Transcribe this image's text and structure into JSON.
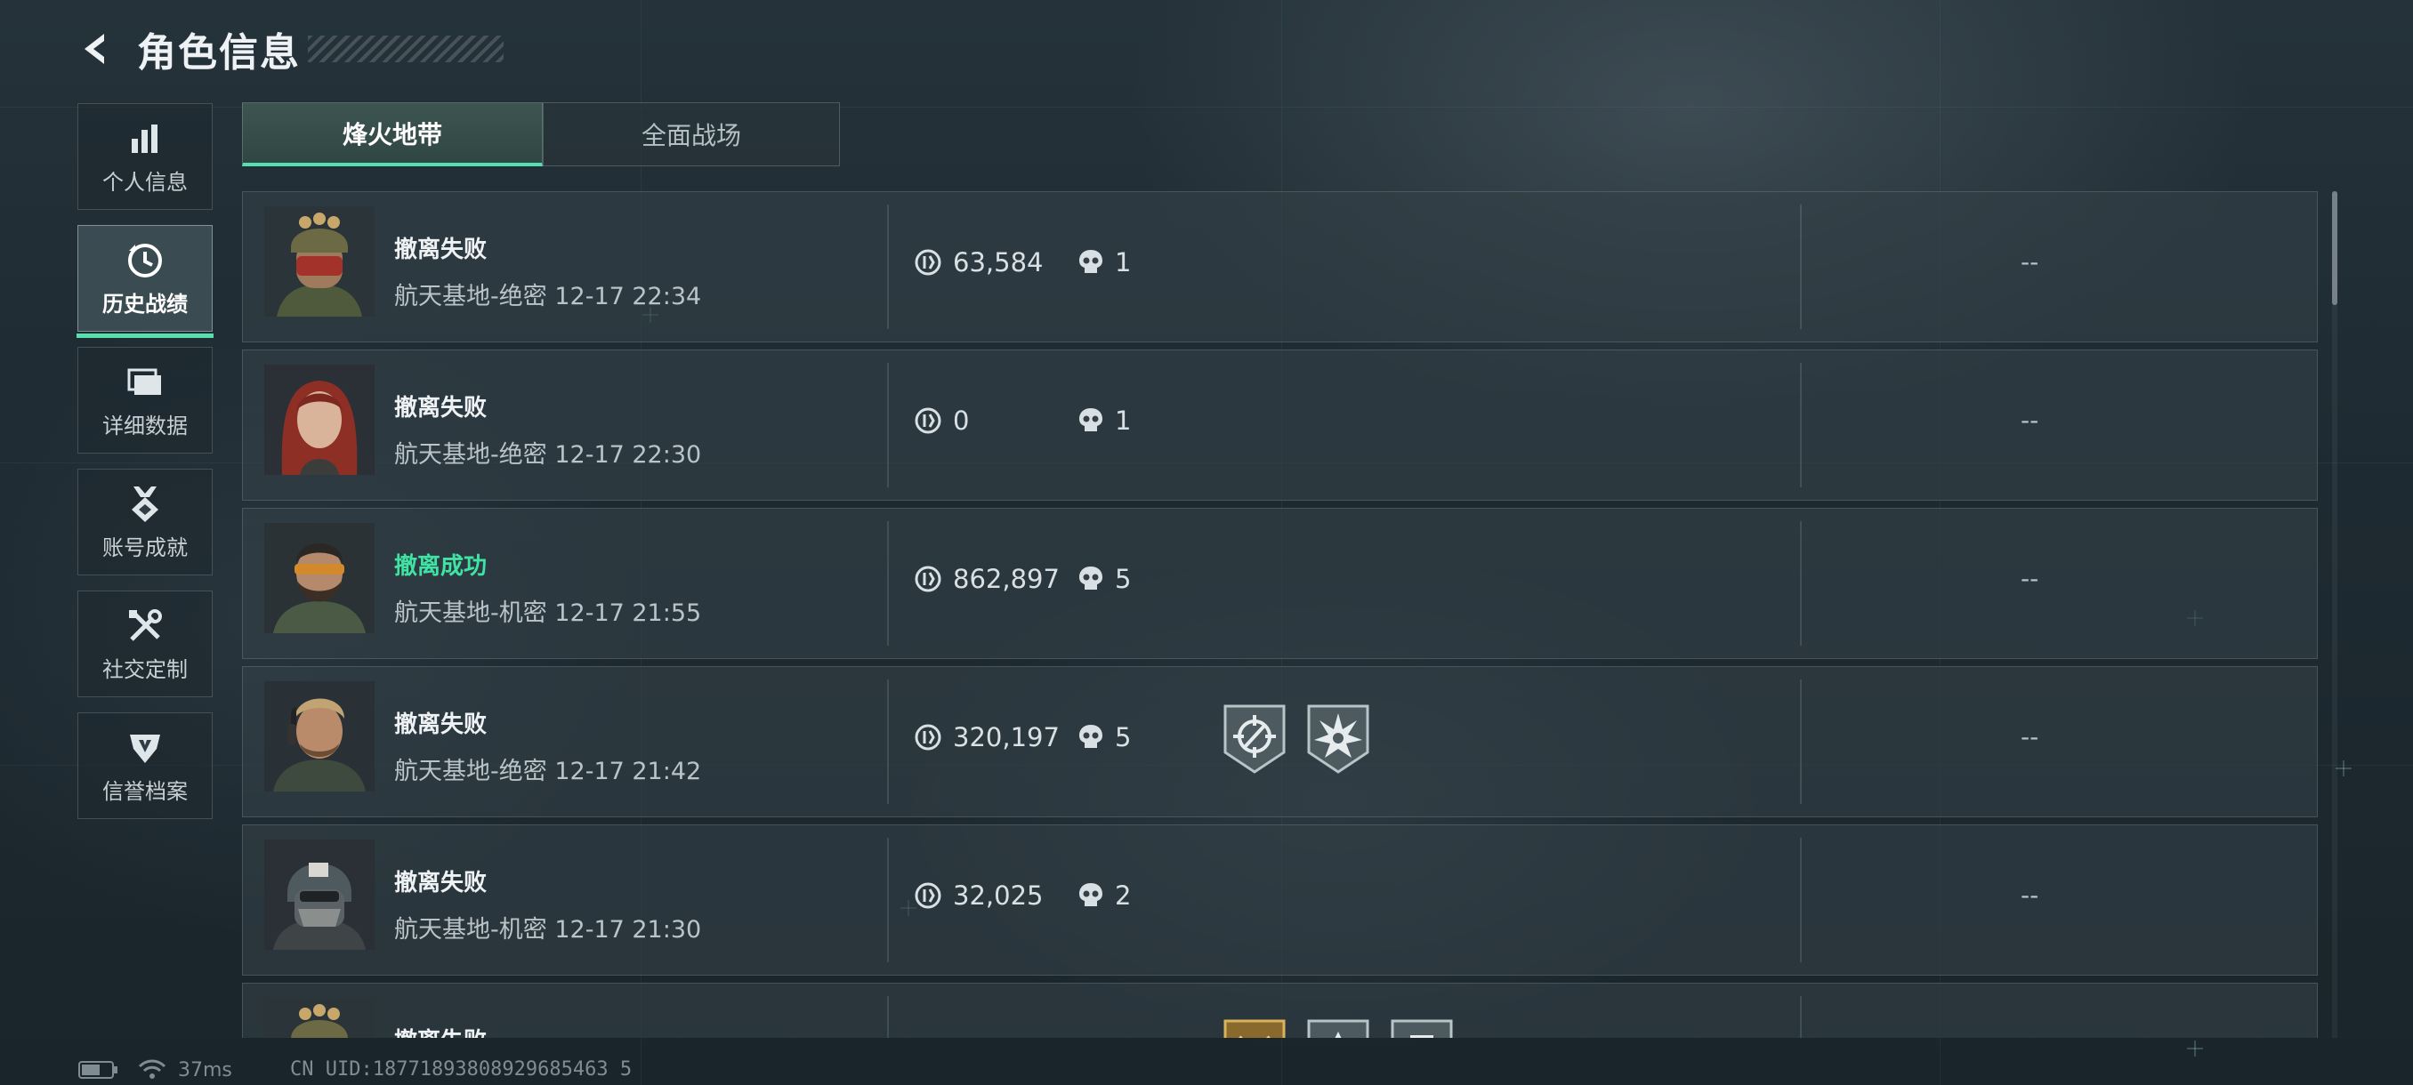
{
  "header": {
    "title": "角色信息",
    "back_icon": "chevron-left-icon"
  },
  "sidebar": {
    "items": [
      {
        "label": "个人信息",
        "icon": "bar-chart-icon",
        "active": false
      },
      {
        "label": "历史战绩",
        "icon": "clock-history-icon",
        "active": true
      },
      {
        "label": "详细数据",
        "icon": "folder-stack-icon",
        "active": false
      },
      {
        "label": "账号成就",
        "icon": "medal-icon",
        "active": false
      },
      {
        "label": "社交定制",
        "icon": "tools-icon",
        "active": false
      },
      {
        "label": "信誉档案",
        "icon": "shield-emblem-icon",
        "active": false
      }
    ]
  },
  "tabs": [
    {
      "label": "烽火地带",
      "active": true
    },
    {
      "label": "全面战场",
      "active": false
    }
  ],
  "records": [
    {
      "status": "撤离失败",
      "success": false,
      "map": "航天基地-绝密",
      "time": "12-17 22:34",
      "value": "63,584",
      "kills": "1",
      "extra": "--",
      "avatar": "operator-helmet-goggles"
    },
    {
      "status": "撤离失败",
      "success": false,
      "map": "航天基地-绝密",
      "time": "12-17 22:30",
      "value": "0",
      "kills": "1",
      "extra": "--",
      "avatar": "operator-red-hair"
    },
    {
      "status": "撤离成功",
      "success": true,
      "map": "航天基地-机密",
      "time": "12-17 21:55",
      "value": "862,897",
      "kills": "5",
      "extra": "--",
      "avatar": "operator-bearded-glasses"
    },
    {
      "status": "撤离失败",
      "success": false,
      "map": "航天基地-绝密",
      "time": "12-17 21:42",
      "value": "320,197",
      "kills": "5",
      "extra": "--",
      "avatar": "operator-headset",
      "badges": [
        "crosshair-badge-icon",
        "burst-badge-icon"
      ]
    },
    {
      "status": "撤离失败",
      "success": false,
      "map": "航天基地-机密",
      "time": "12-17 21:30",
      "value": "32,025",
      "kills": "2",
      "extra": "--",
      "avatar": "operator-masked-helmet"
    },
    {
      "status": "撤离失败",
      "success": false,
      "avatar": "operator-helmet-goggles",
      "badges": [
        "gold-rank-badge-icon",
        "silver-badge-icon",
        "silver-badge-icon"
      ]
    }
  ],
  "statusbar": {
    "ping": "37ms",
    "uid": "CN UID:18771893808929685463 5"
  },
  "colors": {
    "accent": "#56e0b0",
    "success": "#3fe3a3"
  }
}
